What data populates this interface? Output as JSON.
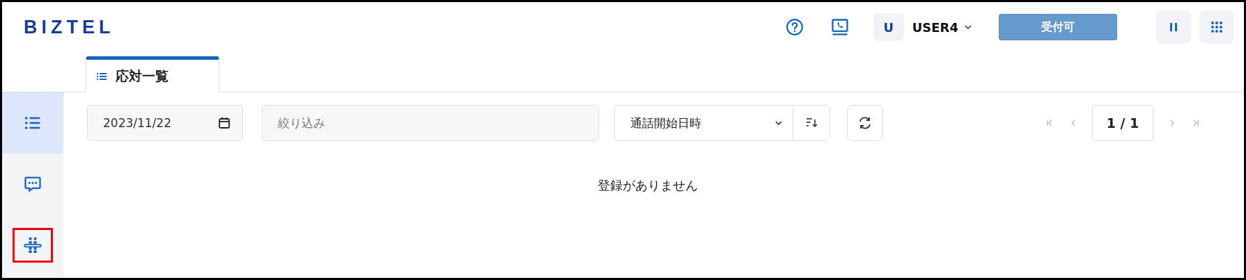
{
  "header": {
    "logo": "BIZTEL",
    "user": {
      "avatar": "U",
      "name": "USER4"
    },
    "status_button": "受付可"
  },
  "tabs": [
    {
      "label": "応対一覧",
      "selected": true
    }
  ],
  "sidebar": {
    "items": [
      {
        "kind": "list",
        "selected": true,
        "highlighted": false
      },
      {
        "kind": "chat",
        "selected": false,
        "highlighted": false
      },
      {
        "kind": "group",
        "selected": false,
        "highlighted": true
      }
    ]
  },
  "toolbar": {
    "date": "2023/11/22",
    "filter": {
      "placeholder": "絞り込み"
    },
    "sort_select": "通話開始日時"
  },
  "pagination": {
    "page": "1 / 1",
    "nav": [
      {
        "kind": "first",
        "disabled": true
      },
      {
        "kind": "prev",
        "disabled": true
      },
      {
        "kind": "next",
        "disabled": true
      },
      {
        "kind": "last",
        "disabled": true
      }
    ]
  },
  "empty_message": "登録がありません"
}
